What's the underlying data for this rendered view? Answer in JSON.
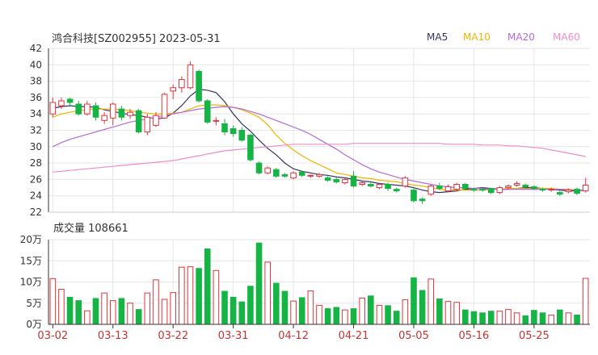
{
  "header": {
    "title": "鸿合科技[SZ002955] 2023-05-31"
  },
  "legend": [
    {
      "label": "MA5",
      "color": "#333366"
    },
    {
      "label": "MA10",
      "color": "#f0b400"
    },
    {
      "label": "MA20",
      "color": "#b36ad6"
    },
    {
      "label": "MA60",
      "color": "#f08ccc"
    }
  ],
  "volume_panel": {
    "label": "成交量 108661"
  },
  "colors": {
    "up": "#e1343c",
    "down": "#16b445",
    "grid": "#e6e6e6",
    "axis": "#333333",
    "xtick": "#c23531"
  },
  "chart_data": [
    {
      "type": "candlestick",
      "title": "鸿合科技[SZ002955] 2023-05-31",
      "ylim": [
        22,
        42
      ],
      "yticks": [
        22,
        24,
        26,
        28,
        30,
        32,
        34,
        36,
        38,
        40,
        42
      ],
      "xticks": [
        "03-02",
        "03-13",
        "03-22",
        "03-31",
        "04-12",
        "04-21",
        "05-05",
        "05-16",
        "05-25"
      ],
      "xtick_index": [
        0,
        7,
        14,
        21,
        28,
        35,
        42,
        49,
        56
      ],
      "candles": [
        [
          34.0,
          35.4,
          36.0,
          33.6
        ],
        [
          35.0,
          35.6,
          36.0,
          34.6
        ],
        [
          35.8,
          35.4,
          36.0,
          35.0
        ],
        [
          35.2,
          34.0,
          35.6,
          33.8
        ],
        [
          34.0,
          35.2,
          35.6,
          33.8
        ],
        [
          35.0,
          33.6,
          35.4,
          33.2
        ],
        [
          33.2,
          33.8,
          34.2,
          32.8
        ],
        [
          33.5,
          35.2,
          35.4,
          32.6
        ],
        [
          34.6,
          33.6,
          35.0,
          33.2
        ],
        [
          33.8,
          34.2,
          34.6,
          33.4
        ],
        [
          34.4,
          31.8,
          34.6,
          31.6
        ],
        [
          31.8,
          33.6,
          34.0,
          31.4
        ],
        [
          32.6,
          33.8,
          34.2,
          32.4
        ],
        [
          33.5,
          36.4,
          36.6,
          33.4
        ],
        [
          36.8,
          37.2,
          37.6,
          35.8
        ],
        [
          37.2,
          38.2,
          38.6,
          36.6
        ],
        [
          37.2,
          40.0,
          40.4,
          37.0
        ],
        [
          39.2,
          35.6,
          39.4,
          35.4
        ],
        [
          35.6,
          33.0,
          35.8,
          32.8
        ],
        [
          33.2,
          33.2,
          33.6,
          32.6
        ],
        [
          32.8,
          31.8,
          33.4,
          31.4
        ],
        [
          32.2,
          31.6,
          32.6,
          31.2
        ],
        [
          32.0,
          30.8,
          32.4,
          30.6
        ],
        [
          31.4,
          28.4,
          31.6,
          28.2
        ],
        [
          28.0,
          26.8,
          28.2,
          26.6
        ],
        [
          26.8,
          27.4,
          27.6,
          26.6
        ],
        [
          27.2,
          26.4,
          27.4,
          26.2
        ],
        [
          26.6,
          26.4,
          26.8,
          26.2
        ],
        [
          26.2,
          26.8,
          27.0,
          26.0
        ],
        [
          26.9,
          26.5,
          27.0,
          26.3
        ],
        [
          26.4,
          26.5,
          26.6,
          26.2
        ],
        [
          26.4,
          26.6,
          26.8,
          26.2
        ],
        [
          26.2,
          25.9,
          26.4,
          25.7
        ],
        [
          26.0,
          25.7,
          26.2,
          25.5
        ],
        [
          25.6,
          26.0,
          26.2,
          25.4
        ],
        [
          26.4,
          25.2,
          27.0,
          25.0
        ],
        [
          25.4,
          25.6,
          25.8,
          25.2
        ],
        [
          25.4,
          25.2,
          25.8,
          25.0
        ],
        [
          25.0,
          25.4,
          25.6,
          24.8
        ],
        [
          25.4,
          24.9,
          25.6,
          24.6
        ],
        [
          24.8,
          24.6,
          25.0,
          24.4
        ],
        [
          25.2,
          26.2,
          26.4,
          25.0
        ],
        [
          24.7,
          23.4,
          25.0,
          23.2
        ],
        [
          23.6,
          23.4,
          23.8,
          23.0
        ],
        [
          24.2,
          25.2,
          25.4,
          24.0
        ],
        [
          25.2,
          24.9,
          25.6,
          24.7
        ],
        [
          24.6,
          25.1,
          25.4,
          24.4
        ],
        [
          24.8,
          25.4,
          25.6,
          24.6
        ],
        [
          25.4,
          24.9,
          25.6,
          24.7
        ],
        [
          24.8,
          24.7,
          25.0,
          24.5
        ],
        [
          24.8,
          24.7,
          25.0,
          24.5
        ],
        [
          24.9,
          24.4,
          25.0,
          24.2
        ],
        [
          24.4,
          25.0,
          25.2,
          24.2
        ],
        [
          25.0,
          25.2,
          25.4,
          24.8
        ],
        [
          25.3,
          25.5,
          25.8,
          25.1
        ],
        [
          25.3,
          25.1,
          25.5,
          24.9
        ],
        [
          25.1,
          24.9,
          25.3,
          24.7
        ],
        [
          24.8,
          24.7,
          25.0,
          24.5
        ],
        [
          24.7,
          24.8,
          25.0,
          24.5
        ],
        [
          24.4,
          24.2,
          24.6,
          24.0
        ],
        [
          24.5,
          24.7,
          24.9,
          24.3
        ],
        [
          24.8,
          24.3,
          25.0,
          24.1
        ],
        [
          24.6,
          25.3,
          26.2,
          24.4
        ]
      ],
      "ma": {
        "MA5": [
          34.7,
          34.9,
          35.0,
          34.9,
          34.9,
          34.8,
          34.5,
          34.3,
          34.1,
          33.9,
          33.8,
          33.6,
          33.4,
          33.5,
          34.1,
          35.0,
          36.2,
          37.0,
          36.9,
          36.6,
          35.5,
          34.0,
          32.8,
          31.9,
          30.8,
          29.8,
          29.0,
          28.0,
          27.3,
          27.0,
          26.8,
          26.6,
          26.5,
          26.3,
          26.2,
          26.0,
          25.8,
          25.7,
          25.5,
          25.4,
          25.3,
          25.2,
          25.0,
          24.7,
          24.5,
          24.4,
          24.5,
          24.6,
          24.8,
          24.9,
          25.0,
          24.9,
          24.8,
          24.8,
          24.9,
          25.0,
          25.0,
          24.9,
          24.8,
          24.7,
          24.6,
          24.6,
          24.7
        ],
        "MA10": [
          33.6,
          34.0,
          34.2,
          34.4,
          34.5,
          34.6,
          34.6,
          34.6,
          34.5,
          34.4,
          34.2,
          34.1,
          34.0,
          34.0,
          34.1,
          34.2,
          34.6,
          35.0,
          35.1,
          35.1,
          35.0,
          34.8,
          34.5,
          34.1,
          33.6,
          32.7,
          31.4,
          30.4,
          29.6,
          28.9,
          28.3,
          27.8,
          27.3,
          26.8,
          26.6,
          26.4,
          26.2,
          26.1,
          25.9,
          25.8,
          25.7,
          25.5,
          25.3,
          25.2,
          25.0,
          24.8,
          24.7,
          24.7,
          24.7,
          24.7,
          24.7,
          24.8,
          24.8,
          24.9,
          24.9,
          24.9,
          24.9,
          24.9,
          24.9,
          24.8,
          24.8,
          24.7,
          24.7
        ],
        "MA20": [
          30.0,
          30.5,
          30.9,
          31.2,
          31.5,
          31.8,
          32.1,
          32.4,
          32.7,
          33.0,
          33.2,
          33.4,
          33.6,
          33.8,
          34.0,
          34.2,
          34.4,
          34.6,
          34.7,
          34.8,
          34.9,
          34.8,
          34.6,
          34.3,
          34.0,
          33.6,
          33.2,
          32.8,
          32.4,
          32.0,
          31.5,
          30.9,
          30.3,
          29.7,
          29.0,
          28.4,
          27.8,
          27.3,
          26.9,
          26.6,
          26.3,
          26.0,
          25.8,
          25.6,
          25.4,
          25.2,
          25.1,
          25.0,
          25.0,
          24.9,
          24.9,
          24.8,
          24.8,
          24.8,
          24.8,
          24.8,
          24.8,
          24.8,
          24.8,
          24.8,
          24.7,
          24.7,
          24.7
        ],
        "MA60": [
          26.9,
          27.0,
          27.1,
          27.2,
          27.3,
          27.4,
          27.5,
          27.6,
          27.7,
          27.8,
          27.9,
          28.0,
          28.1,
          28.2,
          28.3,
          28.5,
          28.7,
          28.9,
          29.1,
          29.3,
          29.5,
          29.6,
          29.7,
          29.8,
          29.9,
          30.0,
          30.1,
          30.2,
          30.3,
          30.3,
          30.3,
          30.3,
          30.3,
          30.3,
          30.3,
          30.4,
          30.4,
          30.4,
          30.4,
          30.4,
          30.4,
          30.4,
          30.4,
          30.4,
          30.4,
          30.4,
          30.3,
          30.3,
          30.3,
          30.3,
          30.2,
          30.2,
          30.2,
          30.1,
          30.1,
          30.0,
          29.9,
          29.8,
          29.6,
          29.4,
          29.2,
          29.0,
          28.8
        ]
      }
    },
    {
      "type": "bar",
      "title": "成交量 108661",
      "ylim": [
        0,
        200000
      ],
      "yticks": [
        "0万",
        "5万",
        "10万",
        "15万",
        "20万"
      ],
      "values": [
        108000,
        83000,
        64000,
        56000,
        32000,
        61000,
        74000,
        56000,
        61000,
        50000,
        35000,
        74000,
        105000,
        59000,
        75000,
        135000,
        136000,
        132000,
        178000,
        127000,
        78000,
        64000,
        53000,
        90000,
        192000,
        147000,
        97000,
        78000,
        55000,
        63000,
        79000,
        45000,
        37000,
        40000,
        34000,
        37000,
        62000,
        67000,
        45000,
        44000,
        31000,
        58000,
        110000,
        80000,
        107000,
        60000,
        54000,
        52000,
        34000,
        30000,
        27000,
        31000,
        31000,
        35000,
        27000,
        20000,
        33000,
        27000,
        22000,
        34000,
        27000,
        22000,
        108661
      ]
    }
  ]
}
